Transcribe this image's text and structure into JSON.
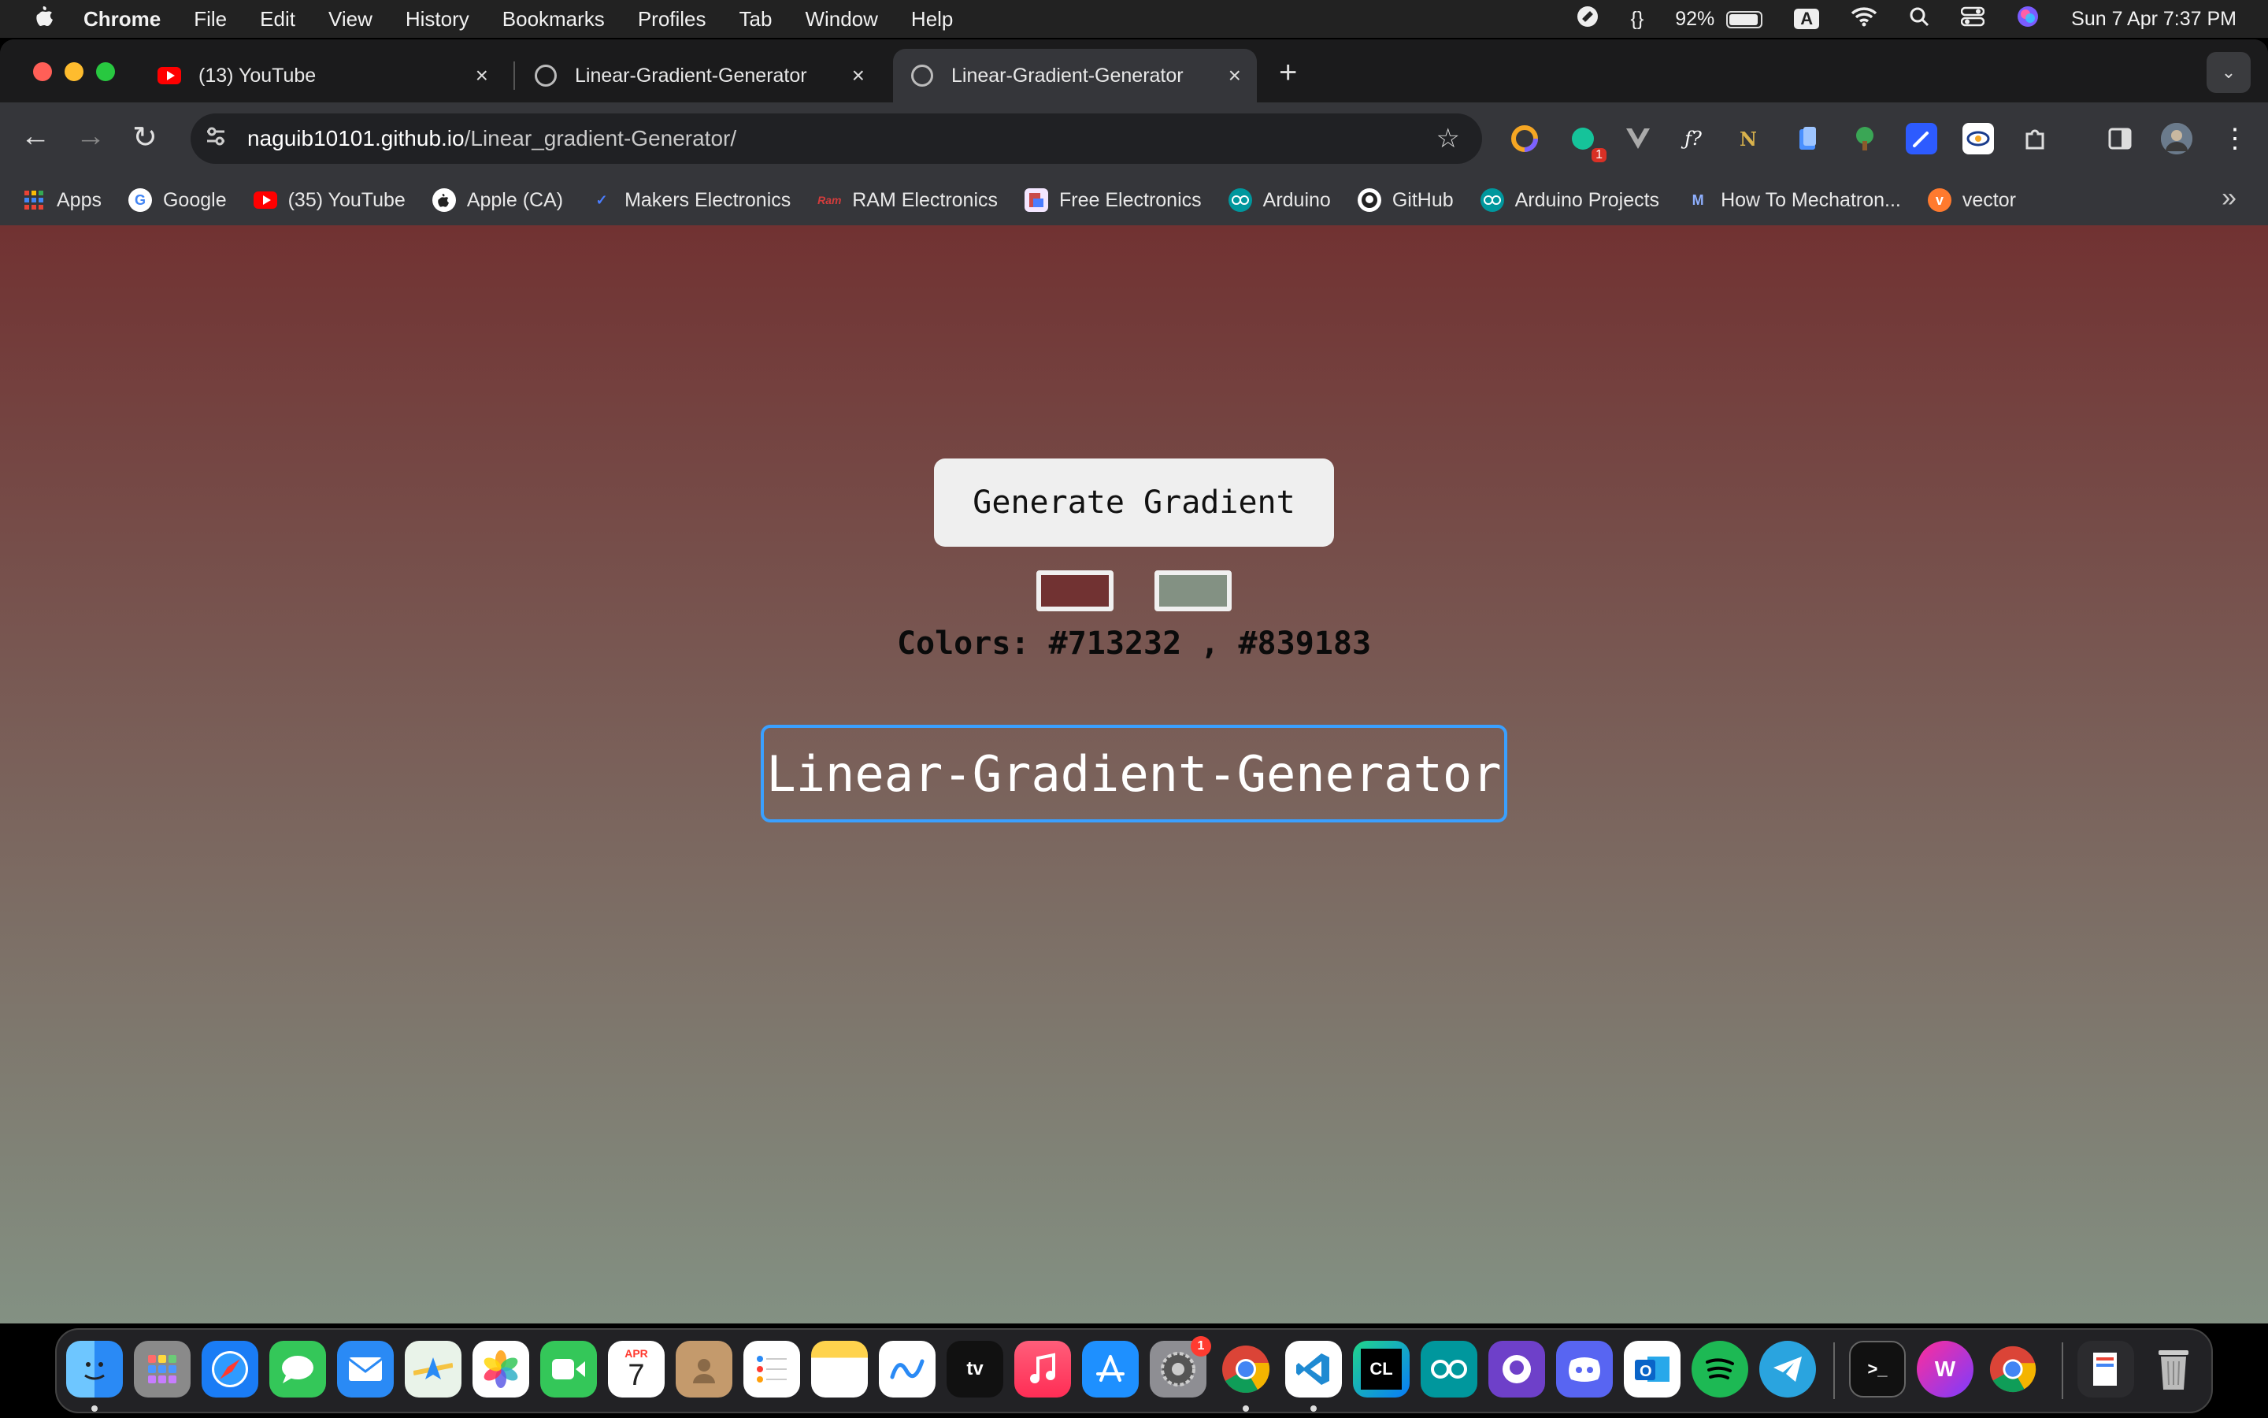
{
  "menubar": {
    "apple": "",
    "items": [
      "Chrome",
      "File",
      "Edit",
      "View",
      "History",
      "Bookmarks",
      "Profiles",
      "Tab",
      "Window",
      "Help"
    ],
    "braces": "{}",
    "battery": "92%",
    "input_source": "A",
    "datetime": "Sun 7 Apr  7:37 PM"
  },
  "tabs": [
    {
      "title": "(13) YouTube",
      "close": "×"
    },
    {
      "title": "Linear-Gradient-Generator",
      "close": "×"
    },
    {
      "title": "Linear-Gradient-Generator",
      "close": "×"
    }
  ],
  "new_tab": "+",
  "tab_search": "⌄",
  "toolbar": {
    "back": "←",
    "forward": "→",
    "reload": "↻",
    "url_host": "naguib10101.github.io",
    "url_path": "/Linear_gradient-Generator/",
    "star": "☆",
    "ext_badge": "1",
    "menu": "⋮"
  },
  "bookmarks": [
    "Apps",
    "Google",
    "(35) YouTube",
    "Apple (CA)",
    "Makers Electronics",
    "RAM Electronics",
    "Free Electronics",
    "Arduino",
    "GitHub",
    "Arduino Projects",
    "How To Mechatron...",
    "vector"
  ],
  "bookmarks_more": "»",
  "page": {
    "button_label": "Generate Gradient",
    "colors_prefix": "Colors:",
    "color1": "#713232",
    "color2": "#839183",
    "colors_sep": ",",
    "title": "Linear-Gradient-Generator",
    "accent": "#3aa0ff"
  },
  "dock": {
    "calendar_month": "APR",
    "calendar_day": "7",
    "settings_badge": "1"
  }
}
